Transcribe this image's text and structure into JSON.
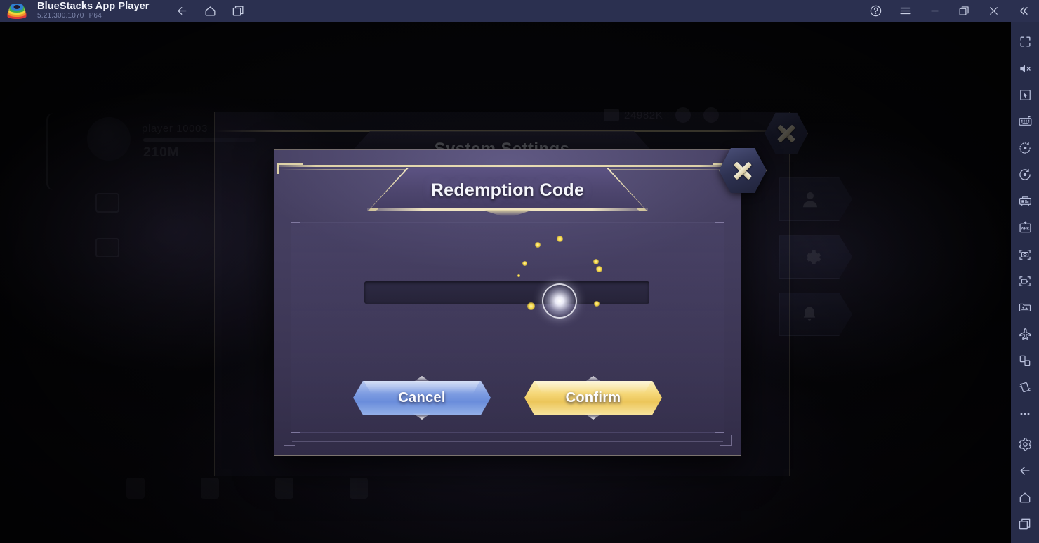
{
  "titlebar": {
    "app_name": "BlueStacks App Player",
    "version": "5.21.300.1070",
    "build": "P64",
    "nav": [
      {
        "name": "back-button",
        "icon": "arrow-left-icon"
      },
      {
        "name": "home-button",
        "icon": "home-icon"
      },
      {
        "name": "recent-apps-button",
        "icon": "recent-apps-icon"
      }
    ],
    "window_controls": [
      {
        "name": "help-button",
        "icon": "help-circle-icon"
      },
      {
        "name": "menu-button",
        "icon": "hamburger-menu-icon"
      },
      {
        "name": "minimize-button",
        "icon": "minimize-icon"
      },
      {
        "name": "maximize-button",
        "icon": "maximize-restore-icon"
      },
      {
        "name": "close-button",
        "icon": "close-x-icon"
      },
      {
        "name": "collapse-sidebar-button",
        "icon": "chevron-double-left-icon"
      }
    ]
  },
  "sidebar": {
    "items": [
      {
        "name": "fullscreen-button",
        "icon": "fullscreen-icon"
      },
      {
        "name": "mute-button",
        "icon": "speaker-mute-icon"
      },
      {
        "name": "cursor-mode-button",
        "icon": "cursor-pointer-icon"
      },
      {
        "name": "keyboard-controls-button",
        "icon": "keyboard-icon"
      },
      {
        "name": "macro-recorder-button",
        "icon": "play-clock-icon"
      },
      {
        "name": "script-recorder-button",
        "icon": "record-dot-icon"
      },
      {
        "name": "multi-instance-button",
        "icon": "multi-instance-icon"
      },
      {
        "name": "install-apk-button",
        "icon": "apk-install-icon"
      },
      {
        "name": "screenshot-button",
        "icon": "camera-icon"
      },
      {
        "name": "record-video-button",
        "icon": "video-camera-icon"
      },
      {
        "name": "media-manager-button",
        "icon": "image-folder-icon"
      },
      {
        "name": "eco-mode-button",
        "icon": "airplane-icon"
      },
      {
        "name": "rotate-button",
        "icon": "rotate-screen-icon"
      },
      {
        "name": "shake-button",
        "icon": "shake-device-icon"
      },
      {
        "name": "more-options-button",
        "icon": "ellipsis-icon"
      },
      {
        "name": "settings-button",
        "icon": "gear-icon"
      },
      {
        "name": "android-back-button",
        "icon": "arrow-left-icon"
      },
      {
        "name": "android-home-button",
        "icon": "home-icon"
      },
      {
        "name": "android-recents-button",
        "icon": "recent-apps-icon"
      }
    ]
  },
  "game": {
    "settings_panel": {
      "title": "System Settings",
      "close_label": "×"
    },
    "hud": {
      "player_name": "player 10003",
      "player_power": "210M",
      "resource_count": "24982K",
      "nav_buttons": [
        {
          "name": "account-nav-button",
          "icon": "person-icon"
        },
        {
          "name": "settings-nav-button",
          "icon": "gear-icon"
        },
        {
          "name": "notifications-nav-button",
          "icon": "bell-icon"
        }
      ],
      "bottom_items": [
        {
          "name": "base-button",
          "label": ""
        },
        {
          "name": "shield-button",
          "label": ""
        },
        {
          "name": "troops-button",
          "label": ""
        },
        {
          "name": "alliance-button",
          "label": ""
        }
      ]
    }
  },
  "dialog": {
    "title": "Redemption Code",
    "close_label": "×",
    "input": {
      "value": "",
      "placeholder": ""
    },
    "buttons": {
      "cancel_label": "Cancel",
      "confirm_label": "Confirm"
    }
  },
  "colors": {
    "titlebar_bg": "#2b3050",
    "sidebar_bg": "#272c49",
    "dialog_body": "#433d5e",
    "dialog_gold": "#ded2a8",
    "cancel_blue": "#7d9ce2",
    "confirm_gold": "#f5d777",
    "spark_yellow": "#f5d641"
  }
}
